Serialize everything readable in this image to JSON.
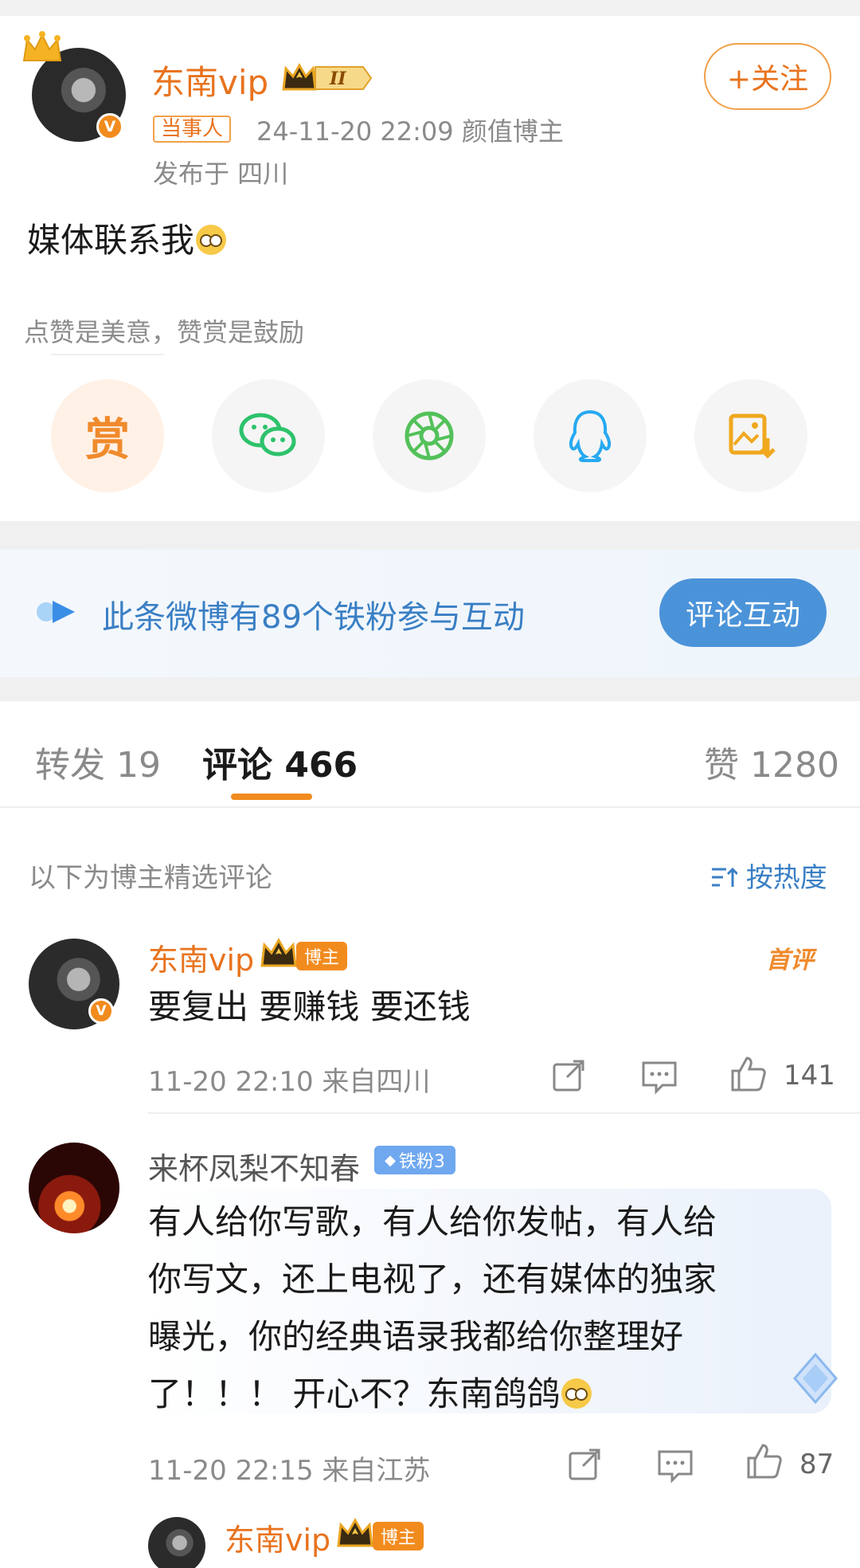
{
  "post": {
    "username": "东南vip",
    "tag": "当事人",
    "time_desc": "24-11-20 22:09  颜值博主",
    "location": "发布于 四川",
    "content": "媒体联系我",
    "follow_label": "+关注",
    "rank_level": "II"
  },
  "reward": {
    "tip": "点赞是美意，赞赏是鼓励",
    "reward_label": "赏",
    "share_targets": [
      "reward",
      "wechat",
      "moments",
      "qq",
      "save-image"
    ]
  },
  "fans_banner": {
    "text": "此条微博有89个铁粉参与互动",
    "button_label": "评论互动"
  },
  "tabs": {
    "repost": "转发 19",
    "comments": "评论 466",
    "likes": "赞 1280"
  },
  "comments_section": {
    "note": "以下为博主精选评论",
    "sort_label": "按热度"
  },
  "comments": [
    {
      "username": "东南vip",
      "badge": "博主",
      "first_tag": "首评",
      "text": "要复出 要赚钱 要还钱",
      "meta": "11-20 22:10  来自四川",
      "likes": "141"
    },
    {
      "username": "来杯凤梨不知春",
      "badge": "铁粉3",
      "text_lines": [
        "有人给你写歌，有人给你发帖，有人给",
        "你写文，还上电视了，还有媒体的独家",
        "曝光，你的经典语录我都给你整理好",
        "了！！！ 开心不？东南鸽鸽"
      ],
      "meta": "11-20 22:15  来自江苏",
      "likes": "87"
    },
    {
      "username": "东南vip",
      "badge": "博主"
    }
  ],
  "colors": {
    "accent_orange": "#e8731e",
    "link_blue": "#3a7fc4",
    "button_blue": "#4b93d9"
  }
}
